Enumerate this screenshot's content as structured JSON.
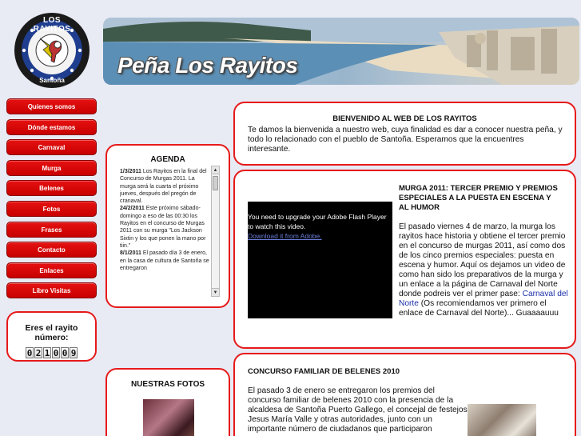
{
  "logo": {
    "top_text": "LOS RAYITOS",
    "bottom_text": "Santoña"
  },
  "banner": {
    "title": "Peña Los Rayitos"
  },
  "nav": {
    "items": [
      {
        "label": "Quienes somos"
      },
      {
        "label": "Dónde estamos"
      },
      {
        "label": "Carnaval"
      },
      {
        "label": "Murga"
      },
      {
        "label": "Belenes"
      },
      {
        "label": "Fotos"
      },
      {
        "label": "Frases"
      },
      {
        "label": "Contacto"
      },
      {
        "label": "Enlaces"
      },
      {
        "label": "Libro Visitas"
      }
    ]
  },
  "visit_counter": {
    "label_line1": "Eres el rayito",
    "label_line2": "número:",
    "digits": [
      "0",
      "2",
      "1",
      "0",
      "0",
      "9"
    ]
  },
  "agenda": {
    "title": "AGENDA",
    "entries": [
      {
        "date": "1/3/2011",
        "text": " Los Rayitos en la final del Concurso de Murgas 2011. La murga será la cuarta el próximo jueves, después del pregón de cranaval."
      },
      {
        "date": "24/2/2011",
        "text": " Este próximo sábado-domingo a eso de las 00:30 los Rayitos en el concurso de Murgas 2011 con su murga \"Los Jackson Sixtin y los que ponen la mano por tiin.\""
      },
      {
        "date": "8/1/2011",
        "text": " El pasado día 3 de enero, en la casa de cultura de Santoña se entregaron"
      }
    ]
  },
  "fotos": {
    "title": "NUESTRAS FOTOS"
  },
  "welcome": {
    "title": "BIENVENIDO AL WEB DE LOS RAYITOS",
    "text": "Te damos la bienvenida a nuestro web, cuya finalidad es dar a conocer nuestra peña, y todo lo relacionado con el pueblo de Santoña. Esperamos que la encuentres interesante."
  },
  "murga": {
    "title": "MURGA 2011: TERCER PREMIO Y PREMIOS ESPECIALES A LA PUESTA EN ESCENA Y AL HUMOR",
    "text_before_link": "El pasado viernes 4 de marzo, la murga los rayitos hace historia y obtiene el tercer premio en el concurso de murgas 2011, así como dos de los cinco premios especiales: puesta en escena y humor. Aquí os dejamos un video de como han sido los preparativos de la murga y un enlace a la página de Carnaval del Norte donde podreis ver el primer pase: ",
    "link_text": "Carnaval del Norte",
    "text_after_link": " (Os recomiendamos ver primero el enlace de Carnaval del Norte)... Guaaaauuu",
    "video_message": "You need to upgrade your Adobe Flash Player to watch this video.",
    "video_link": "Download it from Adobe."
  },
  "belenes": {
    "title": "CONCURSO FAMILIAR DE BELENES 2010",
    "text": "El pasado 3 de enero se entregaron los premios del concurso familiar de belenes 2010 con la presencia de la alcaldesa de Santoña Puerto Gallego, el concejal de festejos Jesus María Valle y otras autoridades, junto con un importante número de ciudadanos que participaron"
  },
  "colors": {
    "accent": "#e61a1a",
    "nav_button": "#d40000",
    "background": "#e8eaf4",
    "link": "#1a2fa8"
  }
}
